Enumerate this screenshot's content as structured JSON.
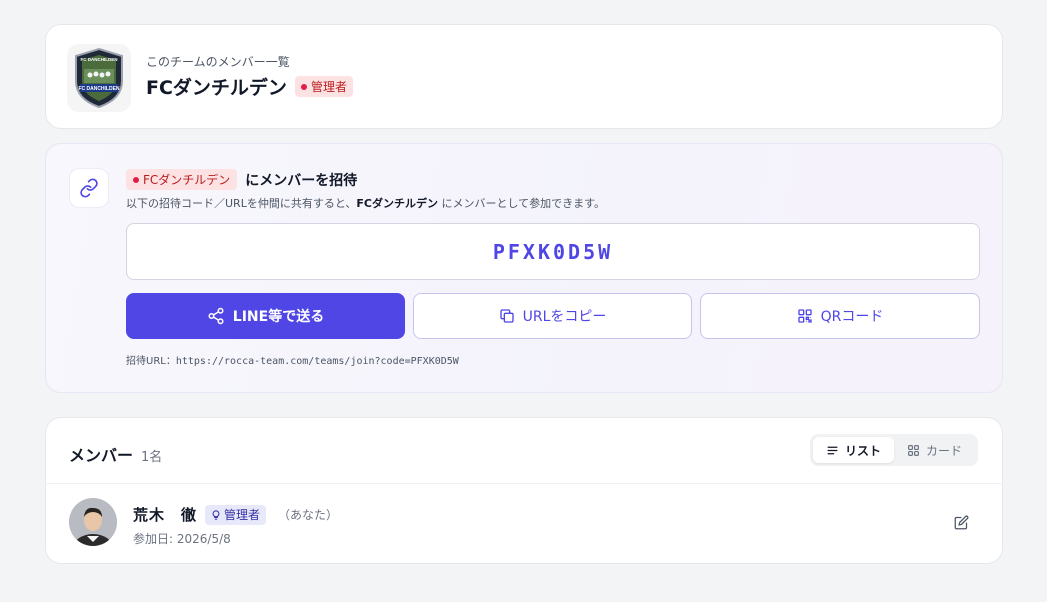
{
  "team": {
    "subtitle": "このチームのメンバー一覧",
    "name": "FCダンチルデン",
    "role_badge": "管理者",
    "logo_top": "FC DANCHILDEN",
    "logo_bottom": "FC DANCHILDEN"
  },
  "invite": {
    "team_tag": "FCダンチルデン",
    "title": "にメンバーを招待",
    "desc_prefix": "以下の招待コード／URLを仲間に共有すると、",
    "desc_team": "FCダンチルデン",
    "desc_suffix": " にメンバーとして参加できます。",
    "code": "PFXK0D5W",
    "buttons": {
      "line": "LINE等で送る",
      "copy": "URLをコピー",
      "qr": "QRコード"
    },
    "url_label": "招待URL：",
    "url": "https://rocca-team.com/teams/join?code=PFXK0D5W"
  },
  "members": {
    "title": "メンバー",
    "count": "1名",
    "view_list": "リスト",
    "view_card": "カード",
    "items": [
      {
        "name": "荒木　徹",
        "role": "管理者",
        "you_label": "（あなた）",
        "joined": "参加日: 2026/5/8"
      }
    ]
  },
  "colors": {
    "accent": "#4f46e5",
    "page_bg": "#f3f4f6",
    "red_badge_bg": "#fde2e4",
    "red_badge_fg": "#b91c1c",
    "admin_badge_bg": "#e7e9fb"
  },
  "icons": [
    "link-icon",
    "share-icon",
    "copy-icon",
    "qr-code-icon",
    "list-icon",
    "grid-icon",
    "lightbulb-icon",
    "edit-icon"
  ]
}
